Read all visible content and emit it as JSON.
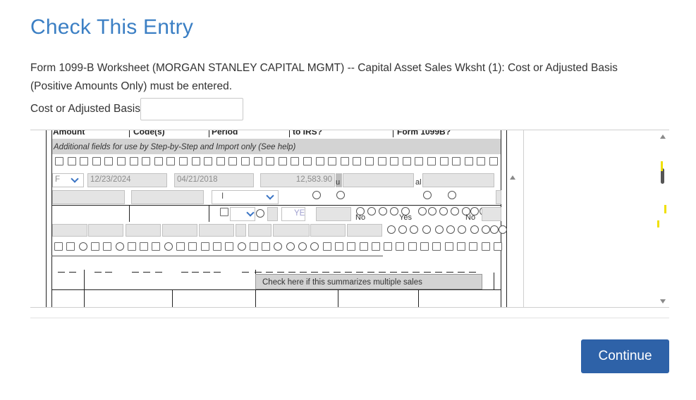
{
  "page": {
    "title": "Check This Entry",
    "message": "Form 1099-B Worksheet (MORGAN STANLEY CAPITAL MGMT) -- Capital Asset Sales Wksht (1): Cost or Adjusted Basis (Positive Amounts Only) must be entered.",
    "field_label": "Cost or Adjusted Basis",
    "field_value": "",
    "continue_label": "Continue"
  },
  "form": {
    "headers": [
      "Amount",
      "Code(s)",
      "Period",
      "to IRS?",
      "Form 1099B?"
    ],
    "additional_fields_note": "Additional fields for use by Step-by-Step and Import only (See help)",
    "select_value": "F",
    "date_sold": "12/23/2024",
    "date_acquired": "04/21/2018",
    "proceeds": "12,583.90",
    "frag_u": "u",
    "frag_al": "al",
    "frag_i": "I",
    "ye_text": "YE",
    "no_label": "No",
    "yes_label": "Yes",
    "no_label_2": "No",
    "summary_checkbox_label": "Check here if this summarizes multiple sales"
  },
  "colors": {
    "title": "#3b7fc4",
    "button": "#2e62a8",
    "checkbox_checked": "#2f6ed8",
    "highlight": "#f0e000"
  }
}
